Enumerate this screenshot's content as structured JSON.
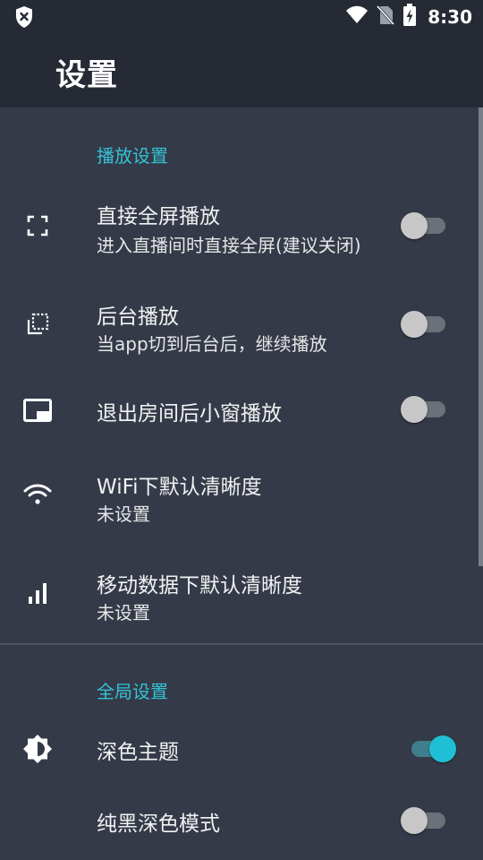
{
  "status_bar": {
    "time": "8:30"
  },
  "app_bar": {
    "title": "设置"
  },
  "sections": {
    "playback": {
      "header": "播放设置",
      "items": [
        {
          "title": "直接全屏播放",
          "subtitle": "进入直播间时直接全屏(建议关闭)",
          "icon": "fullscreen-icon",
          "toggle": false
        },
        {
          "title": "后台播放",
          "subtitle": "当app切到后台后，继续播放",
          "icon": "background-play-icon",
          "toggle": false
        },
        {
          "title": "退出房间后小窗播放",
          "icon": "picture-in-picture-icon",
          "toggle": false
        },
        {
          "title": "WiFi下默认清晰度",
          "subtitle": "未设置",
          "icon": "wifi-icon"
        },
        {
          "title": "移动数据下默认清晰度",
          "subtitle": "未设置",
          "icon": "cellular-signal-icon"
        }
      ]
    },
    "global": {
      "header": "全局设置",
      "items": [
        {
          "title": "深色主题",
          "icon": "brightness-icon",
          "toggle": true
        },
        {
          "title": "纯黑深色模式",
          "toggle": false
        }
      ]
    }
  },
  "colors": {
    "accent": "#35c2d6",
    "background": "#343a48",
    "app_bar": "#252a34"
  }
}
